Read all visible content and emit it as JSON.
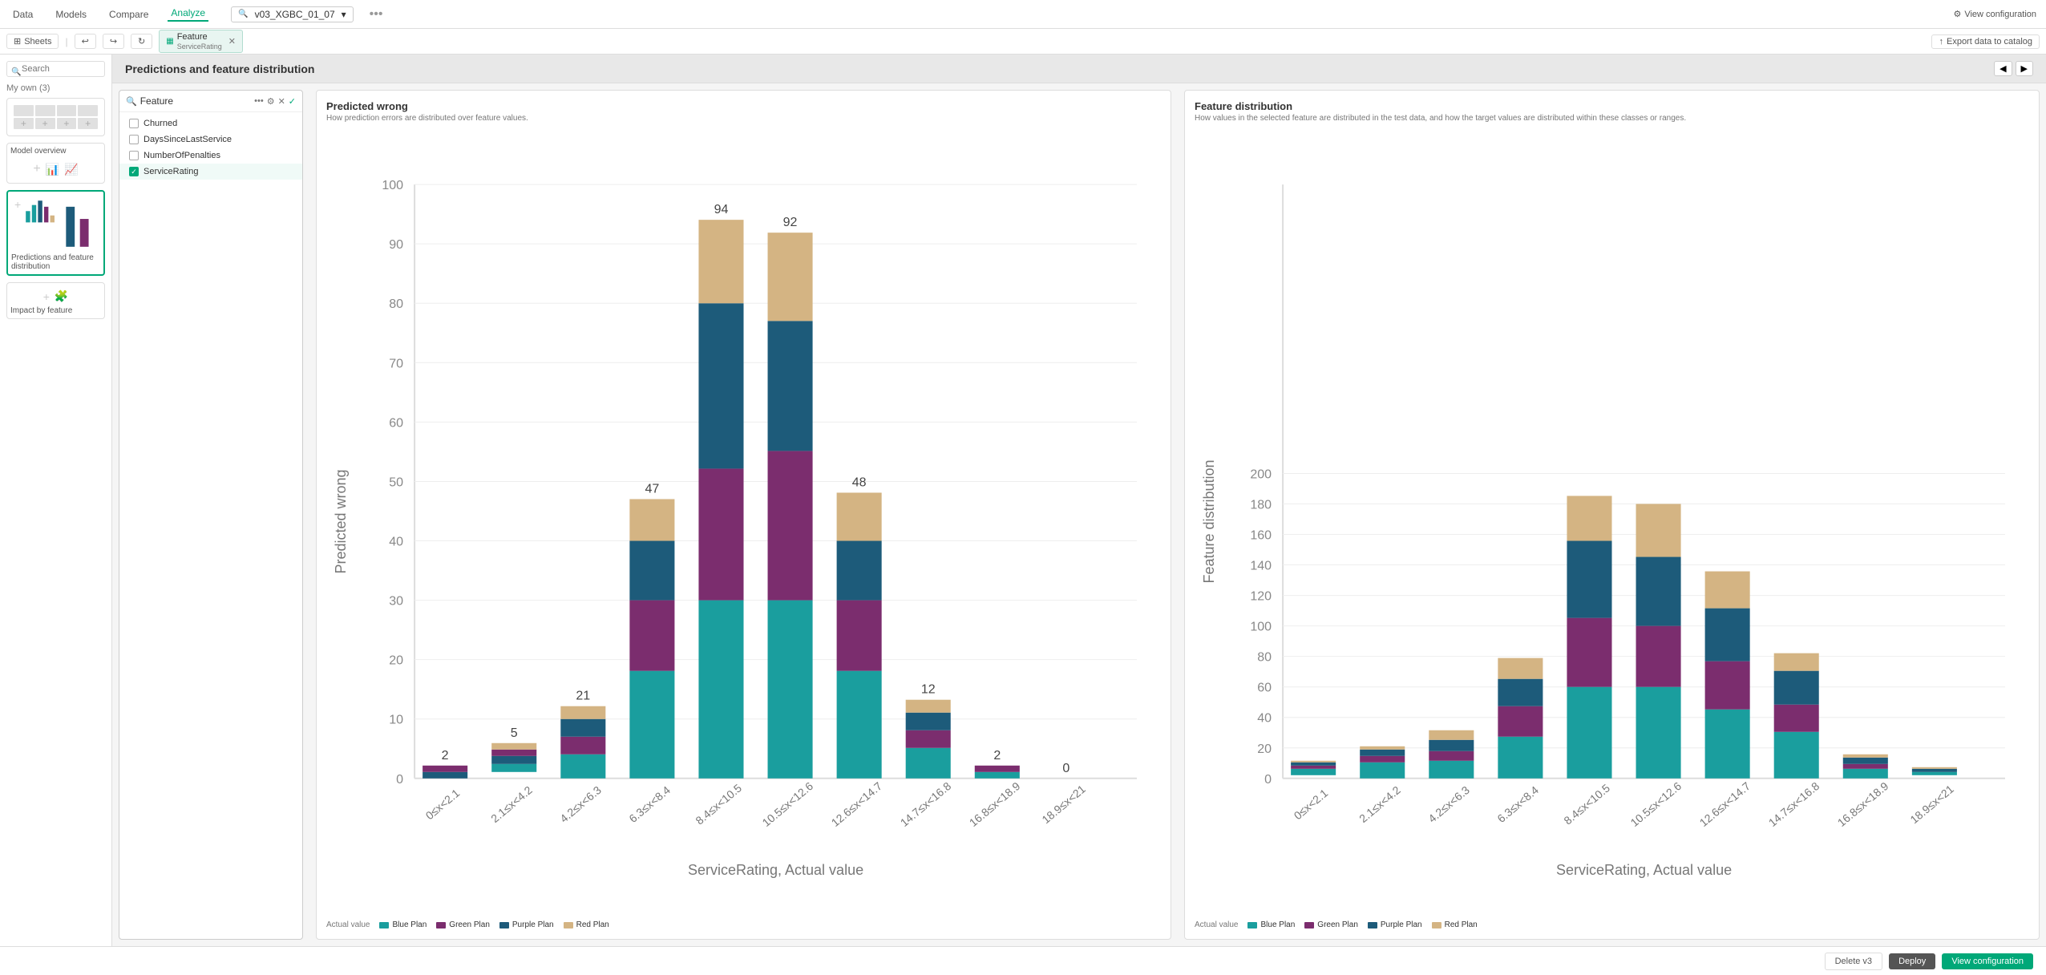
{
  "nav": {
    "items": [
      "Data",
      "Models",
      "Compare",
      "Analyze"
    ],
    "active": "Analyze",
    "model": "v03_XGBC_01_07"
  },
  "toolbar": {
    "sheets_label": "Sheets",
    "tab_name": "Feature",
    "tab_sub": "ServiceRating",
    "export_label": "Export data to catalog",
    "view_config_label": "View configuration"
  },
  "sidebar": {
    "search_placeholder": "Search",
    "section_my_own": "My own (3)",
    "cards": [
      {
        "label": "",
        "type": "mini-grid"
      },
      {
        "label": "Model overview",
        "type": "model-overview"
      },
      {
        "label": "Predictions and feature distribution",
        "type": "predictions",
        "selected": true
      },
      {
        "label": "Impact by feature",
        "type": "impact"
      }
    ]
  },
  "feature_panel": {
    "title": "Feature",
    "features": [
      {
        "name": "Churned",
        "checked": false
      },
      {
        "name": "DaysSinceLastService",
        "checked": false
      },
      {
        "name": "NumberOfPenalties",
        "checked": false
      },
      {
        "name": "ServiceRating",
        "checked": true
      }
    ]
  },
  "predicted_wrong": {
    "title": "Predicted wrong",
    "subtitle": "How prediction errors are distributed over feature values.",
    "x_label": "ServiceRating, Actual value",
    "y_label": "Predicted wrong",
    "x_categories": [
      "0≤x<2.1",
      "2.1≤x<4.2",
      "4.2≤x<6.3",
      "6.3≤x<8.4",
      "8.4≤x<10.5",
      "10.5≤x<12.6",
      "12.6≤x<14.7",
      "14.7≤x<16.8",
      "16.8≤x<18.9",
      "18.9≤x<21"
    ],
    "y_max": 100,
    "bar_totals": [
      2,
      5,
      21,
      47,
      94,
      92,
      48,
      12,
      2,
      0
    ],
    "bars": [
      {
        "blue": 1,
        "green": 0,
        "purple": 1,
        "red": 0
      },
      {
        "blue": 2,
        "green": 0,
        "purple": 2,
        "red": 1
      },
      {
        "blue": 4,
        "green": 3,
        "purple": 10,
        "red": 4
      },
      {
        "blue": 18,
        "green": 12,
        "purple": 10,
        "red": 7
      },
      {
        "blue": 30,
        "green": 22,
        "purple": 28,
        "red": 14
      },
      {
        "blue": 30,
        "green": 25,
        "purple": 22,
        "red": 15
      },
      {
        "blue": 18,
        "green": 12,
        "purple": 10,
        "red": 8
      },
      {
        "blue": 5,
        "green": 3,
        "purple": 2,
        "red": 2
      },
      {
        "blue": 1,
        "green": 0,
        "purple": 1,
        "red": 0
      },
      {
        "blue": 0,
        "green": 0,
        "purple": 0,
        "red": 0
      }
    ]
  },
  "feature_distribution": {
    "title": "Feature distribution",
    "subtitle": "How values in the selected feature are distributed in the test data, and how the target values are distributed within these classes or ranges.",
    "x_label": "ServiceRating, Actual value",
    "y_label": "Feature distribution",
    "y_max": 200,
    "x_categories": [
      "0≤x<2.1",
      "2.1≤x<4.2",
      "4.2≤x<6.3",
      "6.3≤x<8.4",
      "8.4≤x<10.5",
      "10.5≤x<12.6",
      "12.6≤x<14.7",
      "14.7≤x<16.8",
      "16.8≤x<18.9",
      "18.9≤x<21"
    ],
    "bars": [
      {
        "blue": 2,
        "green": 1,
        "purple": 2,
        "red": 1
      },
      {
        "blue": 5,
        "green": 2,
        "purple": 4,
        "red": 2
      },
      {
        "blue": 12,
        "green": 6,
        "purple": 8,
        "red": 6
      },
      {
        "blue": 28,
        "green": 20,
        "purple": 18,
        "red": 14
      },
      {
        "blue": 60,
        "green": 45,
        "purple": 50,
        "red": 30
      },
      {
        "blue": 60,
        "green": 40,
        "purple": 45,
        "red": 35
      },
      {
        "blue": 45,
        "green": 32,
        "purple": 35,
        "red": 25
      },
      {
        "blue": 30,
        "green": 18,
        "purple": 22,
        "red": 12
      },
      {
        "blue": 6,
        "green": 3,
        "purple": 4,
        "red": 3
      },
      {
        "blue": 2,
        "green": 1,
        "purple": 1,
        "red": 1
      }
    ]
  },
  "legend": {
    "actual_value_label": "Actual value",
    "items": [
      {
        "name": "Blue Plan",
        "color": "#1a9e9e"
      },
      {
        "name": "Green Plan",
        "color": "#7b2d6e"
      },
      {
        "name": "Purple Plan",
        "color": "#1d5b7a"
      },
      {
        "name": "Red Plan",
        "color": "#d4b483"
      }
    ]
  },
  "bottom_bar": {
    "delete_label": "Delete v3",
    "deploy_label": "Deploy",
    "view_config_label": "View configuration"
  },
  "colors": {
    "blue_plan": "#1a9e9e",
    "green_plan": "#7b2d6e",
    "purple_plan": "#1d5b7a",
    "red_plan": "#d4b483",
    "accent": "#00a878"
  }
}
